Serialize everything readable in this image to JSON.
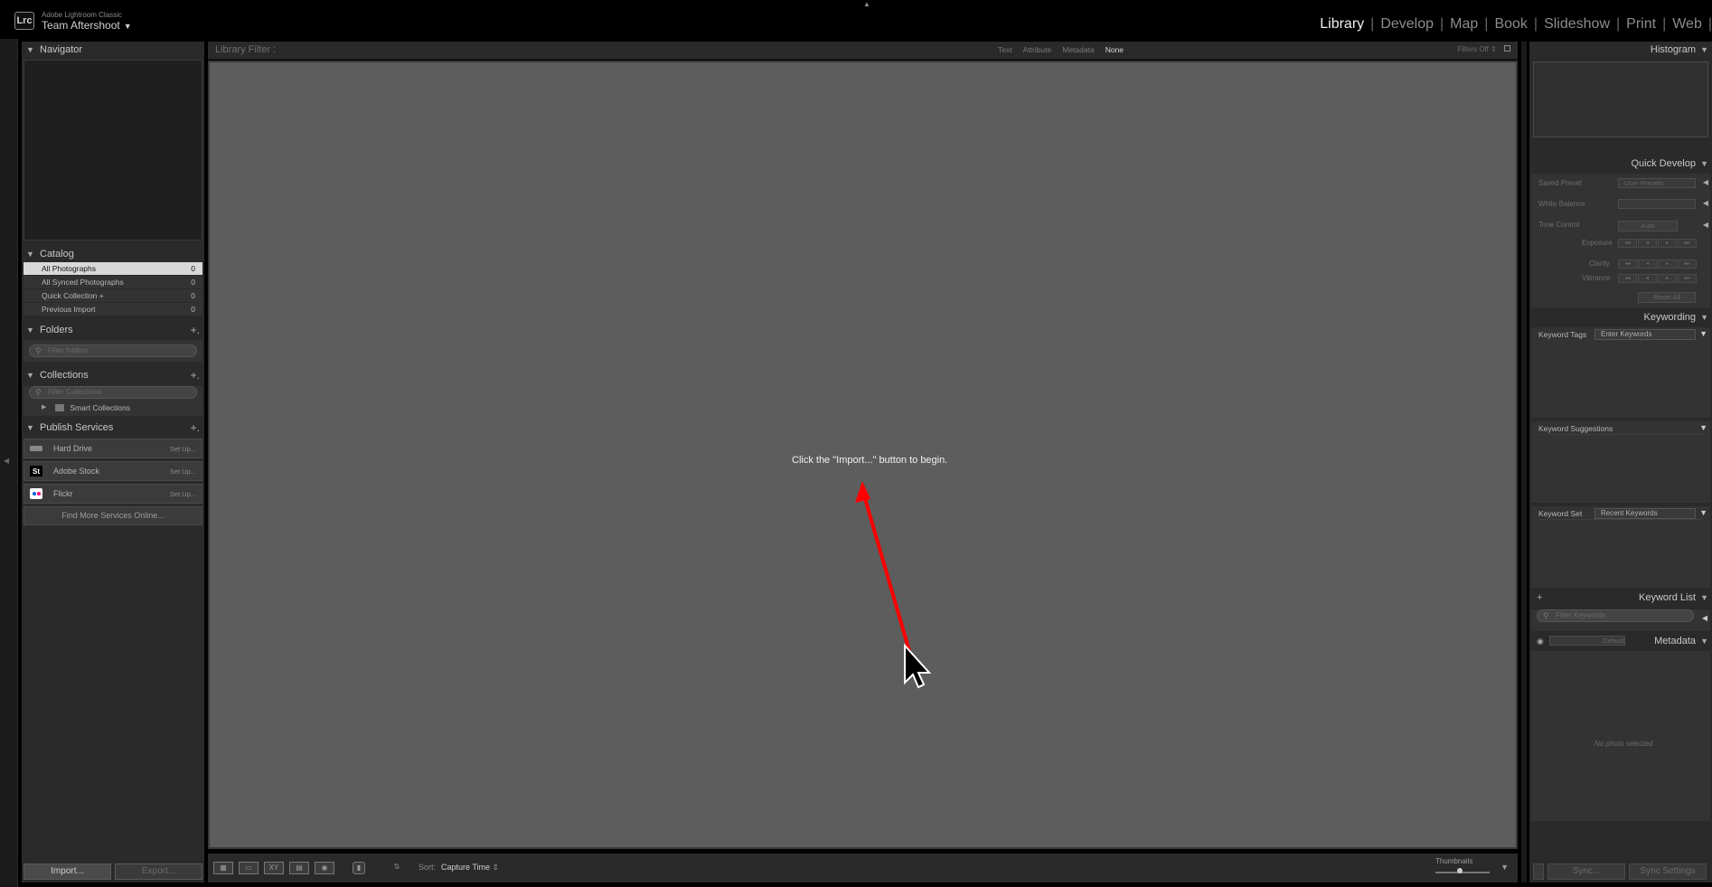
{
  "app": {
    "product": "Adobe Lightroom Classic",
    "logo_text": "Lrc",
    "catalog_owner": "Team Aftershoot",
    "caret": "▼"
  },
  "modules": [
    "Library",
    "Develop",
    "Map",
    "Book",
    "Slideshow",
    "Print",
    "Web"
  ],
  "active_module": "Library",
  "left_panel": {
    "navigator": {
      "title": "Navigator"
    },
    "catalog": {
      "title": "Catalog",
      "items": [
        {
          "label": "All Photographs",
          "count": "0",
          "selected": true
        },
        {
          "label": "All Synced Photographs",
          "count": "0"
        },
        {
          "label": "Quick Collection +",
          "count": "0"
        },
        {
          "label": "Previous Import",
          "count": "0"
        }
      ]
    },
    "folders": {
      "title": "Folders",
      "search_placeholder": "Filter folders"
    },
    "collections": {
      "title": "Collections",
      "search_placeholder": "Filter Collections",
      "smart_label": "Smart Collections"
    },
    "publish": {
      "title": "Publish Services",
      "services": [
        {
          "name": "Hard Drive",
          "icon": "hard-drive-icon",
          "setup": "Set Up..."
        },
        {
          "name": "Adobe Stock",
          "icon": "adobe-stock-icon",
          "icon_text": "St",
          "setup": "Set Up..."
        },
        {
          "name": "Flickr",
          "icon": "flickr-icon",
          "setup": "Set Up..."
        }
      ],
      "find_more": "Find More Services Online..."
    },
    "import_button": "Import...",
    "export_button": "Export..."
  },
  "filter_bar": {
    "label": "Library Filter :",
    "options": [
      "Text",
      "Attribute",
      "Metadata",
      "None"
    ],
    "active": "None",
    "filters_status": "Filters Off"
  },
  "main": {
    "message": "Click the \"Import...\" button to begin."
  },
  "toolbar": {
    "sort_label": "Sort:",
    "sort_value": "Capture Time",
    "thumbnails_label": "Thumbnails"
  },
  "right_panel": {
    "histogram": {
      "title": "Histogram"
    },
    "quick_develop": {
      "title": "Quick Develop",
      "saved_preset_label": "Saved Preset",
      "saved_preset_value": "User Presets",
      "white_balance_label": "White Balance",
      "tone_control_label": "Tone Control",
      "auto_label": "Auto",
      "exposure_label": "Exposure",
      "clarity_label": "Clarity",
      "vibrance_label": "Vibrance",
      "step_buttons": [
        "◂◂",
        "◂",
        "▸",
        "▸▸"
      ],
      "reset_label": "Reset All"
    },
    "keywording": {
      "title": "Keywording",
      "tags_label": "Keyword Tags",
      "tags_value": "Enter Keywords",
      "suggestions_label": "Keyword Suggestions",
      "set_label": "Keyword Set",
      "set_value": "Recent Keywords"
    },
    "keyword_list": {
      "title": "Keyword List",
      "search_placeholder": "Filter Keywords"
    },
    "metadata": {
      "title": "Metadata",
      "preset_value": "Default",
      "empty": "No photo selected"
    },
    "sync_button": "Sync...",
    "sync_settings_button": "Sync Settings"
  },
  "colors": {
    "annotation_arrow": "#ff0000",
    "accent_selected": "#d8d8d8"
  }
}
